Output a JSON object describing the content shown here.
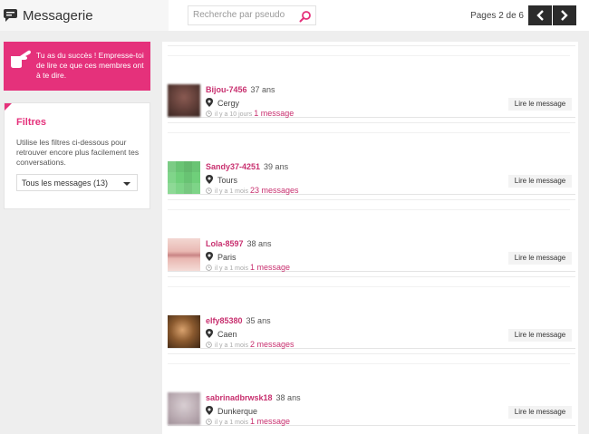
{
  "header": {
    "title": "Messagerie",
    "search_placeholder": "Recherche par pseudo",
    "pagination": "Pages 2 de 6"
  },
  "promo": {
    "text": "Tu as du succès ! Empresse-toi de lire ce que ces membres ont à te dire."
  },
  "filters": {
    "title": "Filtres",
    "description": "Utilise les filtres ci-dessous pour retrouver encore plus facilement tes conversations.",
    "selected": "Tous les messages (13)"
  },
  "messages": [
    {
      "username": "Bijou-7456",
      "age": "37 ans",
      "city": "Cergy",
      "time": "il y a 10 jours",
      "count": "1 message",
      "button": "Lire le message"
    },
    {
      "username": "Sandy37-4251",
      "age": "39 ans",
      "city": "Tours",
      "time": "il y a 1 mois",
      "count": "23 messages",
      "button": "Lire le message"
    },
    {
      "username": "Lola-8597",
      "age": "38 ans",
      "city": "Paris",
      "time": "il y a 1 mois",
      "count": "1 message",
      "button": "Lire le message"
    },
    {
      "username": "elfy85380",
      "age": "35 ans",
      "city": "Caen",
      "time": "il y a 1 mois",
      "count": "2 messages",
      "button": "Lire le message"
    },
    {
      "username": "sabrinadbrwsk18",
      "age": "38 ans",
      "city": "Dunkerque",
      "time": "il y a 1 mois",
      "count": "1 message",
      "button": "Lire le message"
    }
  ],
  "colors": {
    "accent": "#e5317b",
    "link": "#c8306f",
    "nav": "#2b2b2b"
  },
  "icons": {
    "title": "chat-bubble-icon",
    "search": "search-icon",
    "prev": "chevron-left-icon",
    "next": "chevron-right-icon",
    "promo": "pointing-hand-icon",
    "location": "map-pin-icon",
    "time": "clock-icon"
  }
}
